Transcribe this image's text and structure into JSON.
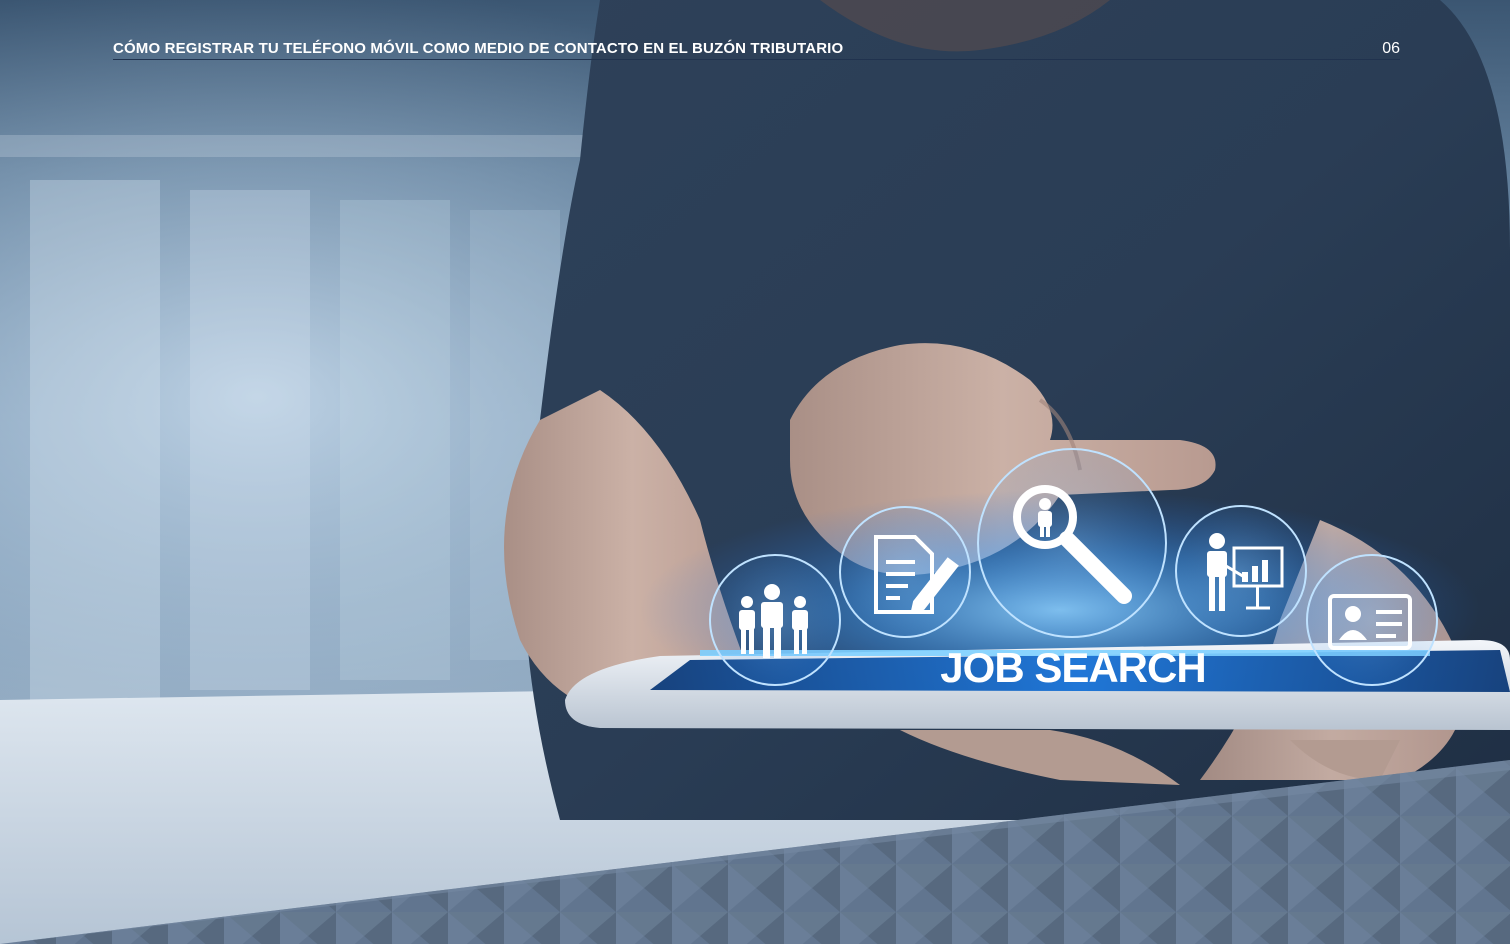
{
  "header": {
    "title": "CÓMO REGISTRAR TU TELÉFONO MÓVIL COMO MEDIO DE CONTACTO EN EL BUZÓN TRIBUTARIO",
    "page_number": "06"
  },
  "photo": {
    "screen_label": "JOB SEARCH",
    "icons": [
      "team-icon",
      "document-edit-icon",
      "person-search-icon",
      "presentation-chart-icon",
      "id-card-icon"
    ]
  },
  "colors": {
    "header_rule": "#20324e",
    "hologram_glow": "#4fb4ff",
    "band": "#61758f"
  }
}
